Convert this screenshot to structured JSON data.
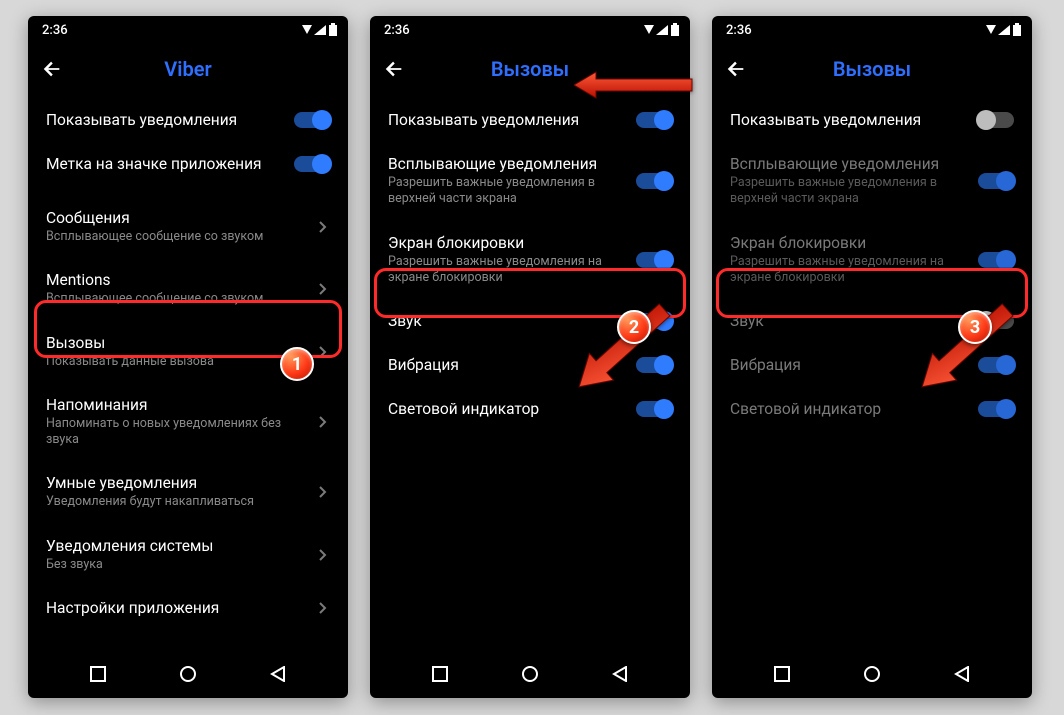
{
  "status": {
    "time": "2:36"
  },
  "screen1": {
    "title": "Viber",
    "rows": {
      "show_notifications": {
        "title": "Показывать уведомления"
      },
      "badge": {
        "title": "Метка на значке приложения"
      },
      "messages": {
        "title": "Сообщения",
        "sub": "Всплывающее сообщение со звуком"
      },
      "mentions": {
        "title": "Mentions",
        "sub": "Всплывающее сообщение со звуком"
      },
      "calls": {
        "title": "Вызовы",
        "sub": "Показывать данные вызова"
      },
      "reminders": {
        "title": "Напоминания",
        "sub": "Напоминать о новых уведомлениях без звука"
      },
      "smart": {
        "title": "Умные уведомления",
        "sub": "Уведомления будут накапливаться"
      },
      "system": {
        "title": "Уведомления системы",
        "sub": "Без звука"
      },
      "app_settings": {
        "title": "Настройки приложения"
      }
    }
  },
  "screen2": {
    "title": "Вызовы",
    "rows": {
      "show_notifications": {
        "title": "Показывать уведомления"
      },
      "popups": {
        "title": "Всплывающие уведомления",
        "sub": "Разрешить важные уведомления в верхней части экрана"
      },
      "lock_screen": {
        "title": "Экран блокировки",
        "sub": "Разрешить важные уведомления на экране блокировки"
      },
      "sound": {
        "title": "Звук"
      },
      "vibration": {
        "title": "Вибрация"
      },
      "light": {
        "title": "Световой индикатор"
      }
    }
  },
  "screen3": {
    "title": "Вызовы",
    "rows": {
      "show_notifications": {
        "title": "Показывать уведомления"
      },
      "popups": {
        "title": "Всплывающие уведомления",
        "sub": "Разрешить важные уведомления в верхней части экрана"
      },
      "lock_screen": {
        "title": "Экран блокировки",
        "sub": "Разрешить важные уведомления на экране блокировки"
      },
      "sound": {
        "title": "Звук"
      },
      "vibration": {
        "title": "Вибрация"
      },
      "light": {
        "title": "Световой индикатор"
      }
    }
  },
  "badges": {
    "b1": "1",
    "b2": "2",
    "b3": "3"
  }
}
